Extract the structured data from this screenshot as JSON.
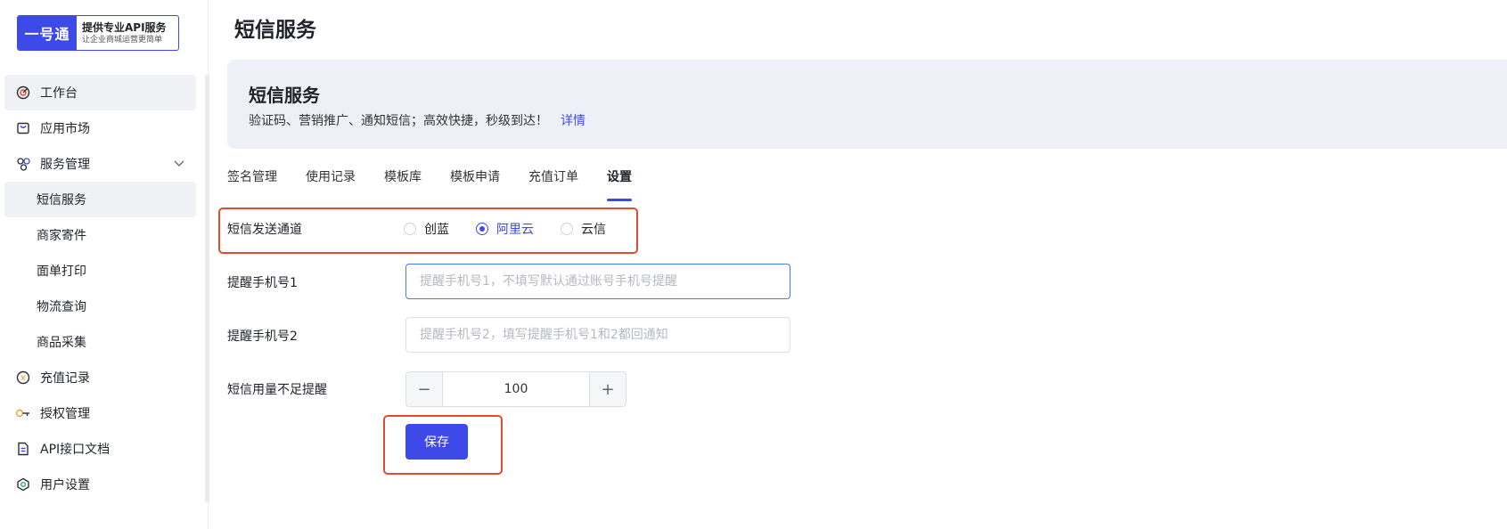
{
  "logo": {
    "mark": "一号通",
    "title": "提供专业API服务",
    "subtitle": "让企业商城运营更简单"
  },
  "sidebar": {
    "items": [
      {
        "label": "工作台",
        "icon": "dashboard-icon",
        "active": true
      },
      {
        "label": "应用市场",
        "icon": "shopping-bag-icon"
      },
      {
        "label": "服务管理",
        "icon": "services-icon",
        "expanded": true
      },
      {
        "label": "短信服务",
        "child": true,
        "active": true
      },
      {
        "label": "商家寄件",
        "child": true
      },
      {
        "label": "面单打印",
        "child": true
      },
      {
        "label": "物流查询",
        "child": true
      },
      {
        "label": "商品采集",
        "child": true
      },
      {
        "label": "充值记录",
        "icon": "recharge-icon"
      },
      {
        "label": "授权管理",
        "icon": "key-icon"
      },
      {
        "label": "API接口文档",
        "icon": "document-icon"
      },
      {
        "label": "用户设置",
        "icon": "user-settings-icon"
      }
    ]
  },
  "page": {
    "title": "短信服务"
  },
  "banner": {
    "title": "短信服务",
    "description": "验证码、营销推广、通知短信；高效快捷，秒级到达！",
    "link": "详情"
  },
  "tabs": [
    {
      "label": "签名管理"
    },
    {
      "label": "使用记录"
    },
    {
      "label": "模板库"
    },
    {
      "label": "模板申请"
    },
    {
      "label": "充值订单"
    },
    {
      "label": "设置",
      "active": true
    }
  ],
  "form": {
    "channel": {
      "label": "短信发送通道",
      "options": [
        {
          "label": "创蓝",
          "checked": false
        },
        {
          "label": "阿里云",
          "checked": true
        },
        {
          "label": "云信",
          "checked": false
        }
      ]
    },
    "phone1": {
      "label": "提醒手机号1",
      "value": "",
      "placeholder": "提醒手机号1，不填写默认通过账号手机号提醒"
    },
    "phone2": {
      "label": "提醒手机号2",
      "value": "",
      "placeholder": "提醒手机号2，填写提醒手机号1和2都回通知"
    },
    "threshold": {
      "label": "短信用量不足提醒",
      "value": "100",
      "minus": "−",
      "plus": "+"
    },
    "save_label": "保存"
  },
  "colors": {
    "accent": "#3e4ae8",
    "highlight": "#e24b30",
    "banner_bg": "#eef0f8"
  }
}
